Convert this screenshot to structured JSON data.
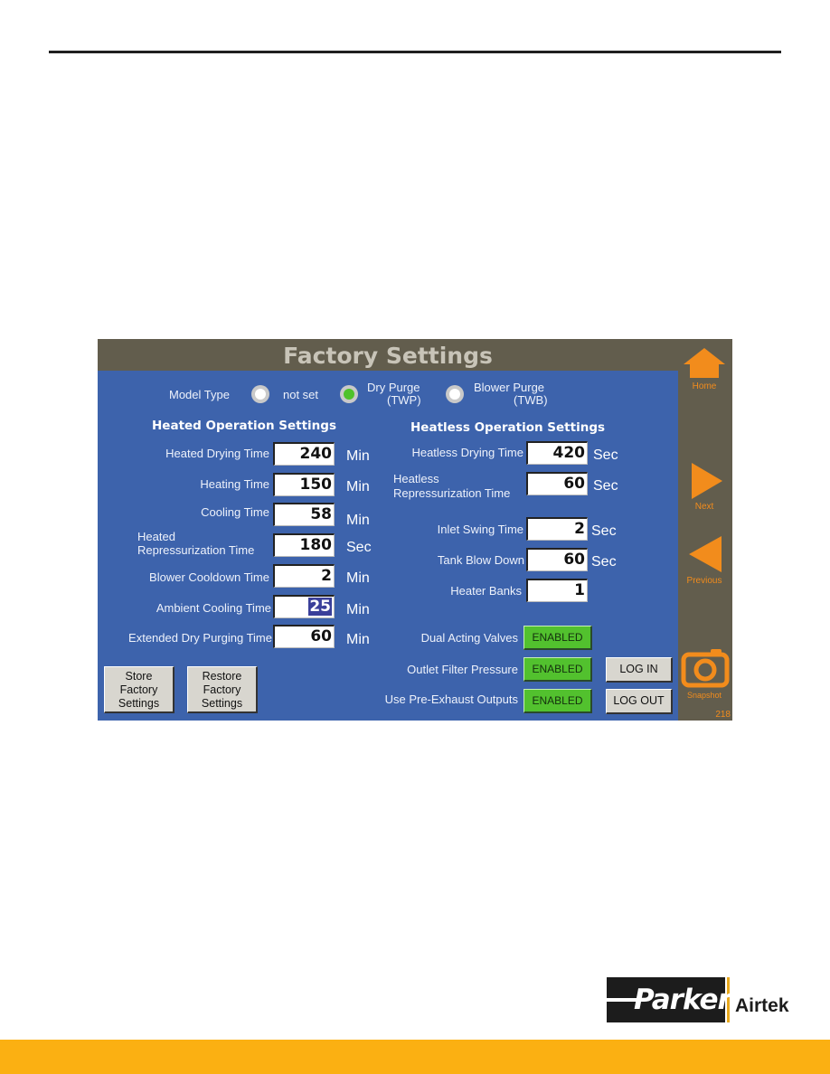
{
  "page": {
    "brand_logo": "Parker",
    "brand_sub": "Airtek",
    "colors": {
      "footer_band": "#fbb012",
      "hmi_blue": "#3d63ac",
      "hmi_frame": "#625d4d",
      "nav_orange": "#f28c1c",
      "enabled_green": "#52c12e"
    }
  },
  "hmi": {
    "title": "Factory Settings",
    "model_type": {
      "label": "Model Type",
      "options": [
        {
          "label": "not set",
          "selected": false
        },
        {
          "label_line1": "Dry Purge",
          "label_line2": "(TWP)",
          "selected": true
        },
        {
          "label_line1": "Blower Purge",
          "label_line2": "(TWB)",
          "selected": false
        }
      ]
    },
    "heated": {
      "heading": "Heated Operation Settings",
      "rows": [
        {
          "label": "Heated Drying Time",
          "value": "240",
          "unit": "Min"
        },
        {
          "label": "Heating Time",
          "value": "150",
          "unit": "Min"
        },
        {
          "label": "Cooling Time",
          "value": "58",
          "unit": "Min"
        },
        {
          "label_line1": "Heated",
          "label_line2": "Repressurization Time",
          "value": "180",
          "unit": "Sec"
        },
        {
          "label": "Blower Cooldown Time",
          "value": "2",
          "unit": "Min"
        },
        {
          "label": "Ambient Cooling Time",
          "value": "25",
          "unit": "Min"
        },
        {
          "label": "Extended Dry Purging Time",
          "value": "60",
          "unit": "Min"
        }
      ]
    },
    "heatless": {
      "heading": "Heatless Operation Settings",
      "rows": [
        {
          "label": "Heatless Drying Time",
          "value": "420",
          "unit": "Sec"
        },
        {
          "label_line1": "Heatless",
          "label_line2": "Repressurization Time",
          "value": "60",
          "unit": "Sec"
        },
        {
          "label": "Inlet Swing Time",
          "value": "2",
          "unit": "Sec"
        },
        {
          "label": "Tank Blow Down",
          "value": "60",
          "unit": "Sec"
        },
        {
          "label": "Heater Banks",
          "value": "1",
          "unit": ""
        }
      ]
    },
    "toggles": [
      {
        "label": "Dual Acting Valves",
        "state": "ENABLED"
      },
      {
        "label": "Outlet Filter Pressure",
        "state": "ENABLED"
      },
      {
        "label": "Use Pre-Exhaust Outputs",
        "state": "ENABLED"
      }
    ],
    "buttons": {
      "store": [
        "Store",
        "Factory",
        "Settings"
      ],
      "restore": [
        "Restore",
        "Factory",
        "Settings"
      ],
      "log_in": "LOG IN",
      "log_out": "LOG OUT"
    },
    "nav": {
      "home": "Home",
      "next": "Next",
      "previous": "Previous",
      "snapshot": "Snapshot",
      "screen_number": "218"
    }
  }
}
